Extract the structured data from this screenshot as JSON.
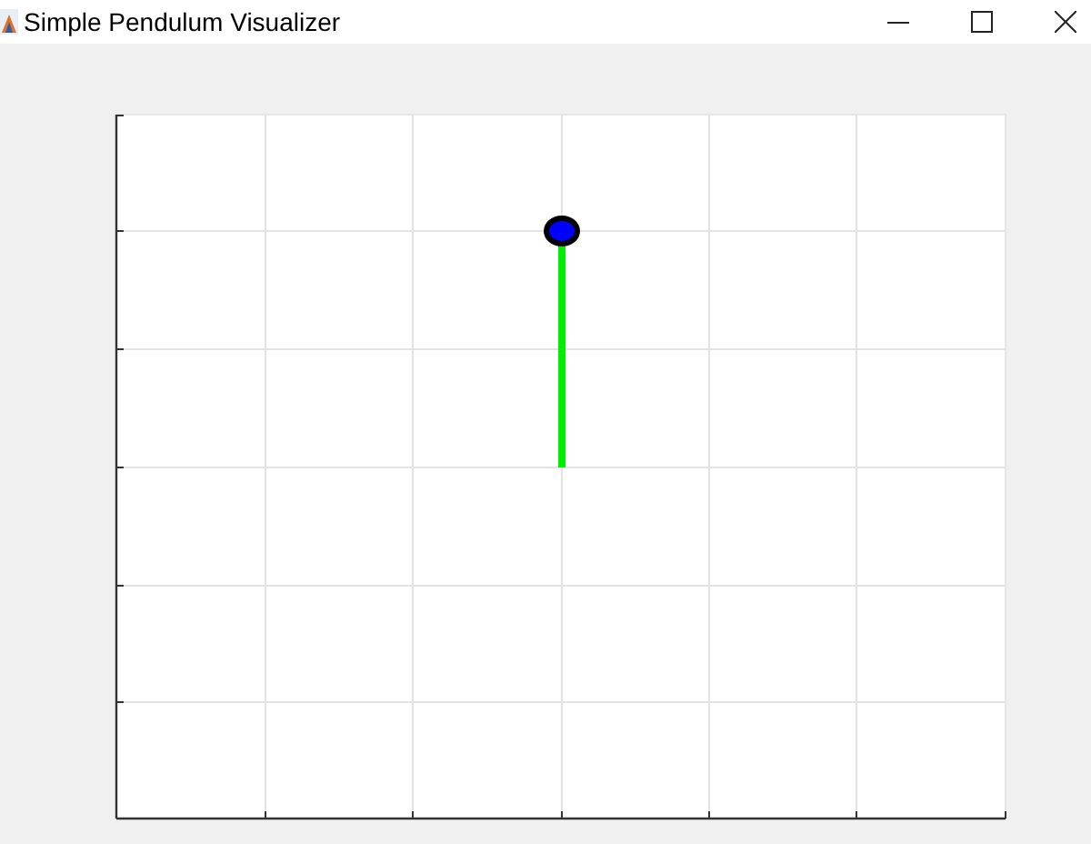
{
  "window": {
    "title": "Simple Pendulum Visualizer"
  }
}
